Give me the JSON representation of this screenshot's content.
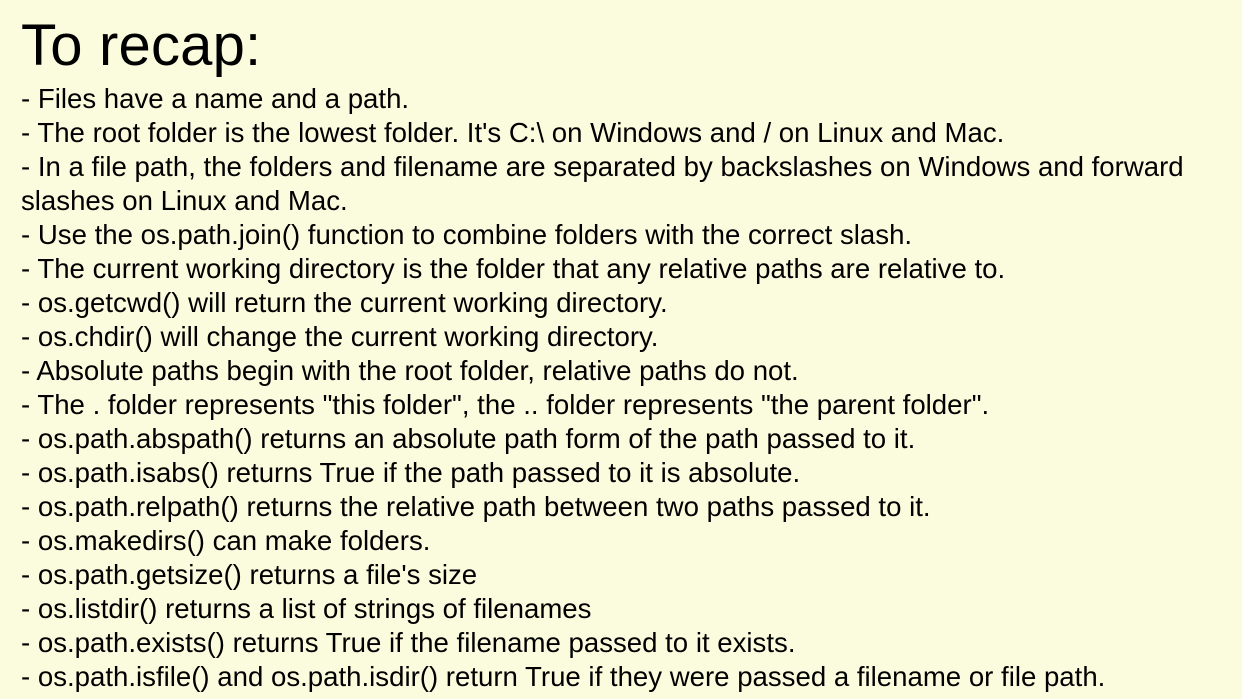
{
  "slide": {
    "title": "To recap:",
    "bullets": [
      "- Files have a name and a path.",
      "- The root folder is the lowest folder. It's C:\\ on Windows and / on Linux and Mac.",
      "- In a file path, the folders and filename are separated by backslashes on Windows and forward slashes on Linux and Mac.",
      "- Use the os.path.join() function to combine folders with the correct slash.",
      "- The current working directory is the folder that any relative paths are relative to.",
      "- os.getcwd() will return the current working directory.",
      "- os.chdir() will change the current working directory.",
      "- Absolute paths begin with the root folder, relative paths do not.",
      "- The . folder represents \"this folder\", the .. folder represents \"the parent folder\".",
      "- os.path.abspath() returns an absolute path form of the path passed to it.",
      "- os.path.isabs() returns True if the path passed to it is absolute.",
      "- os.path.relpath() returns the relative path between two paths passed to it.",
      "- os.makedirs() can make folders.",
      "- os.path.getsize() returns a file's size",
      "- os.listdir() returns a list of strings of filenames",
      "- os.path.exists() returns True if the filename passed to it exists.",
      "- os.path.isfile() and os.path.isdir() return True if they were passed a filename or file path."
    ]
  },
  "colors": {
    "background": "#fbfbdd",
    "text": "#000000"
  }
}
